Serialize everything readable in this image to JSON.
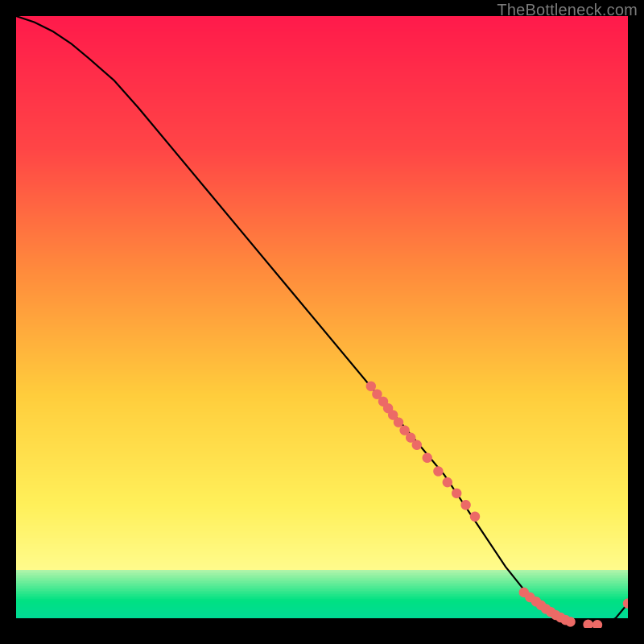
{
  "watermark": "TheBottleneck.com",
  "chart_data": {
    "type": "line",
    "title": "",
    "xlabel": "",
    "ylabel": "",
    "xlim": [
      0,
      100
    ],
    "ylim": [
      0,
      100
    ],
    "grid": false,
    "legend": false,
    "background_gradient_top": "#ff1a4b",
    "background_gradient_mid_upper": "#ff7a3a",
    "background_gradient_mid": "#ffd23a",
    "background_gradient_lower": "#fff56b",
    "background_gradient_bottom_band": "#35e08f",
    "line_color": "#000000",
    "marker_color": "#ec6a66",
    "series": [
      {
        "name": "curve",
        "x": [
          0,
          3,
          6,
          9,
          12,
          16,
          20,
          25,
          30,
          35,
          40,
          45,
          50,
          55,
          60,
          65,
          70,
          72,
          74,
          76,
          78,
          80,
          82,
          84,
          86,
          88,
          90,
          92,
          94,
          96,
          98,
          100
        ],
        "y": [
          100,
          99,
          97.5,
          95.5,
          93,
          89.5,
          85,
          79,
          73,
          67,
          61,
          55,
          49,
          43,
          37,
          31,
          25,
          22,
          19,
          16,
          13,
          10,
          7.5,
          5,
          3,
          1.8,
          1,
          0.6,
          0.5,
          0.5,
          1.6,
          4
        ]
      }
    ],
    "marker_clusters": [
      {
        "comment": "diagonal cluster on descending slope",
        "points": [
          {
            "x": 58,
            "y": 39.5
          },
          {
            "x": 59,
            "y": 38.2
          },
          {
            "x": 60,
            "y": 37.0
          },
          {
            "x": 60.8,
            "y": 35.9
          },
          {
            "x": 61.6,
            "y": 34.8
          },
          {
            "x": 62.5,
            "y": 33.6
          },
          {
            "x": 63.5,
            "y": 32.3
          },
          {
            "x": 64.5,
            "y": 31.1
          },
          {
            "x": 65.5,
            "y": 29.9
          },
          {
            "x": 67.2,
            "y": 27.8
          },
          {
            "x": 69.0,
            "y": 25.6
          },
          {
            "x": 70.5,
            "y": 23.8
          },
          {
            "x": 72.0,
            "y": 22.0
          },
          {
            "x": 73.5,
            "y": 20.1
          },
          {
            "x": 75.0,
            "y": 18.2
          }
        ]
      },
      {
        "comment": "bottom flat cluster",
        "points": [
          {
            "x": 83.0,
            "y": 5.8
          },
          {
            "x": 84.0,
            "y": 5.0
          },
          {
            "x": 85.0,
            "y": 4.3
          },
          {
            "x": 85.8,
            "y": 3.7
          },
          {
            "x": 86.6,
            "y": 3.1
          },
          {
            "x": 87.4,
            "y": 2.6
          },
          {
            "x": 88.2,
            "y": 2.1
          },
          {
            "x": 89.0,
            "y": 1.7
          },
          {
            "x": 89.8,
            "y": 1.3
          },
          {
            "x": 90.6,
            "y": 1.0
          },
          {
            "x": 93.5,
            "y": 0.55
          },
          {
            "x": 95.0,
            "y": 0.5
          }
        ]
      },
      {
        "comment": "final uptick endpoint",
        "points": [
          {
            "x": 100.0,
            "y": 4.0
          }
        ]
      }
    ]
  }
}
